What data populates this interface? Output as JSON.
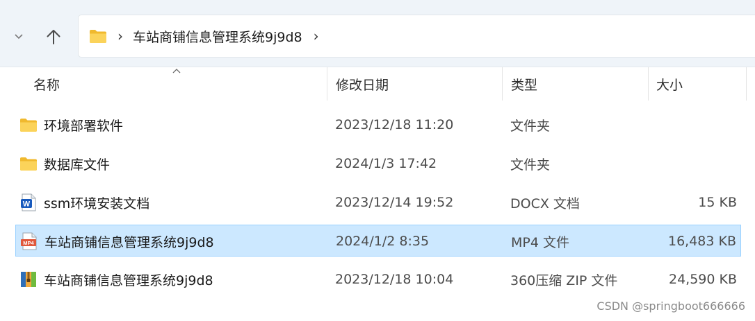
{
  "address_bar": {
    "path_label": "车站商铺信息管理系统9j9d8",
    "separator": "›"
  },
  "columns": {
    "name": "名称",
    "date": "修改日期",
    "type": "类型",
    "size": "大小"
  },
  "files": [
    {
      "icon": "folder-icon",
      "name": "环境部署软件",
      "date": "2023/12/18 11:20",
      "type": "文件夹",
      "size": ""
    },
    {
      "icon": "folder-icon",
      "name": "数据库文件",
      "date": "2024/1/3 17:42",
      "type": "文件夹",
      "size": ""
    },
    {
      "icon": "word-document-icon",
      "name": "ssm环境安装文档",
      "date": "2023/12/14 19:52",
      "type": "DOCX 文档",
      "size": "15 KB"
    },
    {
      "icon": "mp4-video-icon",
      "name": "车站商铺信息管理系统9j9d8",
      "date": "2024/1/2 8:35",
      "type": "MP4 文件",
      "size": "16,483 KB",
      "selected": true
    },
    {
      "icon": "zip-archive-icon",
      "name": "车站商铺信息管理系统9j9d8",
      "date": "2023/12/18 10:04",
      "type": "360压缩 ZIP 文件",
      "size": "24,590 KB"
    }
  ],
  "icon_labels": {
    "word": "W",
    "mp4": "MP4"
  },
  "watermark": "CSDN @springboot666666",
  "colors": {
    "selection_bg": "#cce8ff",
    "selection_border": "#99d1ff",
    "folder_yellow": "#f8c842",
    "word_blue": "#185abd",
    "mp4_red": "#e0583c"
  }
}
